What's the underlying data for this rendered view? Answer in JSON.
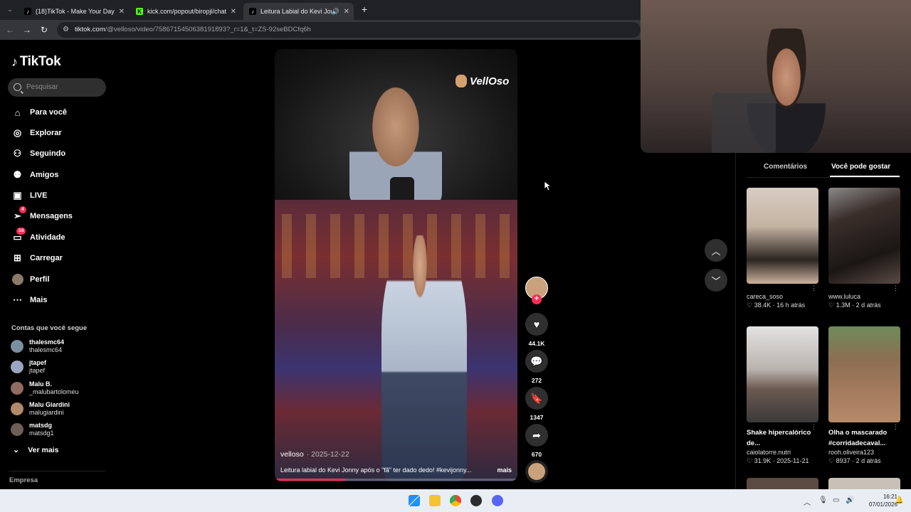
{
  "browser": {
    "tabs": [
      {
        "title": "(18)TikTok - Make Your Day",
        "icon": "tiktok-icon",
        "active": false
      },
      {
        "title": "kick.com/popout/biropjl/chat",
        "icon": "kick-icon",
        "active": false
      },
      {
        "title": "Leitura Labial do Kevi Jonny",
        "icon": "tiktok-icon",
        "active": true
      }
    ],
    "url_domain": "tiktok.com",
    "url_path": "/@velloso/video/7586715450638191893?_r=1&_t=ZS-92seBDCfq6h"
  },
  "sidebar": {
    "logo": "TikTok",
    "search_placeholder": "Pesquisar",
    "nav": [
      {
        "label": "Para você",
        "icon": "home-icon"
      },
      {
        "label": "Explorar",
        "icon": "compass-icon"
      },
      {
        "label": "Seguindo",
        "icon": "following-icon"
      },
      {
        "label": "Amigos",
        "icon": "friends-icon"
      },
      {
        "label": "LIVE",
        "icon": "live-icon"
      },
      {
        "label": "Mensagens",
        "icon": "messages-icon",
        "badge": "4"
      },
      {
        "label": "Atividade",
        "icon": "activity-icon",
        "badge": "14"
      },
      {
        "label": "Carregar",
        "icon": "upload-icon"
      },
      {
        "label": "Perfil",
        "icon": "profile-avatar-icon"
      },
      {
        "label": "Mais",
        "icon": "more-icon"
      }
    ],
    "following_title": "Contas que você segue",
    "accounts": [
      {
        "name": "thalesmc64",
        "handle": "thalesmc64"
      },
      {
        "name": "jtapef",
        "handle": "jtapef"
      },
      {
        "name": "Malu B.",
        "handle": "_malubartolomeu"
      },
      {
        "name": "Malu Giardini",
        "handle": "malugiardini"
      },
      {
        "name": "matsdg",
        "handle": "matsdg1"
      }
    ],
    "see_more": "Ver mais",
    "company": "Empresa"
  },
  "video": {
    "watermark": "VellOso",
    "author": "velloso",
    "date": "· 2025-12-22",
    "caption": "Leitura labial do Kevi Jonny após o \"fã\" ter dado dedo! #kevijonny...",
    "more": "mais",
    "progress": 0.29
  },
  "actions": {
    "likes": "44.1K",
    "comments": "272",
    "saves": "1347",
    "shares": "670"
  },
  "right_panel": {
    "tabs": [
      "Comentários",
      "Você pode gostar"
    ],
    "cards": [
      {
        "title": "",
        "user": "careca_soso",
        "likes": "38.4K",
        "age": "· 16 h atrás"
      },
      {
        "title": "",
        "user": "www.luluca",
        "likes": "1.3M",
        "age": "· 2 d atrás"
      },
      {
        "title": "Shake hipercalórico de...",
        "user": "caiolatorre.nutri",
        "likes": "31.9K",
        "age": "· 2025-11-21"
      },
      {
        "title": "Olha o mascarado #corridadecaval...",
        "user": "rooh.oliveira123",
        "likes": "8937",
        "age": "· 2 d atrás"
      }
    ]
  },
  "taskbar": {
    "time": "16:21",
    "date": "07/01/2026"
  },
  "colors": {
    "accent": "#fe2c55",
    "background": "#000000",
    "chrome_dark": "#202124"
  }
}
